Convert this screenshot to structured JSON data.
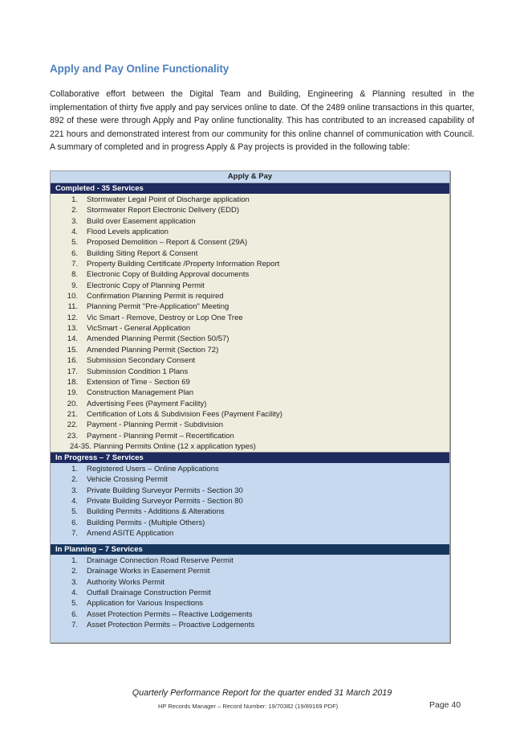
{
  "heading": "Apply and Pay Online Functionality",
  "intro": "Collaborative effort between the Digital Team and Building, Engineering & Planning resulted in the implementation of thirty five apply and pay services online to date.  Of the 2489 online transactions in this quarter, 892 of these were through Apply and Pay online functionality. This has contributed to an increased capability of 221 hours and demonstrated interest from our community for this online channel of communication with Council.  A summary of completed and in progress Apply & Pay projects is provided in the following table:",
  "table": {
    "title": "Apply & Pay",
    "colors": {
      "title_bg": "#c6d9ef",
      "header_navy": "#1f2a5e",
      "header_dark": "#17365d",
      "completed_bg": "#eeeedf",
      "blue_bg": "#c6d9ef"
    },
    "completed": {
      "header": "Completed  - 35 Services",
      "items": [
        {
          "num": "1.",
          "text": "Stormwater Legal Point of Discharge application"
        },
        {
          "num": "2.",
          "text": "Stormwater Report Electronic Delivery (EDD)"
        },
        {
          "num": "3.",
          "text": "Build over Easement application"
        },
        {
          "num": "4.",
          "text": "Flood Levels application"
        },
        {
          "num": "5.",
          "text": "Proposed Demolition – Report & Consent (29A)"
        },
        {
          "num": "6.",
          "text": "Building Siting Report & Consent"
        },
        {
          "num": "7.",
          "text": "Property Building Certificate /Property Information Report"
        },
        {
          "num": "8.",
          "text": "Electronic Copy of Building Approval documents"
        },
        {
          "num": "9.",
          "text": "Electronic Copy of Planning Permit"
        },
        {
          "num": "10.",
          "text": "Confirmation Planning Permit is required"
        },
        {
          "num": "11.",
          "text": "Planning Permit \"Pre-Application\" Meeting"
        },
        {
          "num": "12.",
          "text": "Vic Smart - Remove, Destroy or Lop One Tree"
        },
        {
          "num": "13.",
          "text": "VicSmart - General Application"
        },
        {
          "num": "14.",
          "text": "Amended Planning Permit (Section 50/57)"
        },
        {
          "num": "15.",
          "text": "Amended Planning Permit (Section 72)"
        },
        {
          "num": "16.",
          "text": "Submission Secondary Consent"
        },
        {
          "num": "17.",
          "text": "Submission Condition 1 Plans"
        },
        {
          "num": "18.",
          "text": "Extension of Time - Section 69"
        },
        {
          "num": "19.",
          "text": "Construction Management Plan"
        },
        {
          "num": "20.",
          "text": "Advertising Fees (Payment Facility)"
        },
        {
          "num": "21.",
          "text": "Certification of Lots & Subdivision Fees (Payment Facility)"
        },
        {
          "num": "22.",
          "text": "Payment - Planning Permit - Subdivision"
        },
        {
          "num": "23.",
          "text": "Payment - Planning Permit – Recertification"
        }
      ],
      "final_item": "24-35. Planning Permits Online (12 x application types)"
    },
    "in_progress": {
      "header": "In Progress – 7 Services",
      "items": [
        {
          "num": "1.",
          "text": "Registered Users – Online Applications"
        },
        {
          "num": "2.",
          "text": "Vehicle Crossing Permit"
        },
        {
          "num": "3.",
          "text": "Private Building Surveyor Permits - Section 30"
        },
        {
          "num": "4.",
          "text": "Private Building Surveyor Permits - Section 80"
        },
        {
          "num": "5.",
          "text": "Building Permits - Additions & Alterations"
        },
        {
          "num": "6.",
          "text": "Building Permits - (Multiple Others)"
        },
        {
          "num": "7.",
          "text": "Amend ASITE Application"
        }
      ]
    },
    "in_planning": {
      "header": "In Planning – 7 Services",
      "items": [
        {
          "num": "1.",
          "text": "Drainage Connection Road Reserve Permit"
        },
        {
          "num": "2.",
          "text": "Drainage Works in Easement Permit"
        },
        {
          "num": "3.",
          "text": "Authority Works Permit"
        },
        {
          "num": "4.",
          "text": "Outfall Drainage Construction Permit"
        },
        {
          "num": "5.",
          "text": "Application for Various Inspections"
        },
        {
          "num": "6.",
          "text": "Asset Protection Permits – Reactive Lodgements"
        },
        {
          "num": "7.",
          "text": "Asset Protection Permits – Proactive Lodgements"
        }
      ]
    }
  },
  "footer": {
    "title": "Quarterly Performance Report for the quarter ended 31 March 2019",
    "record": "HP Records Manager – Record Number: 19/70382 (19/89169 PDF)",
    "page": "Page 40"
  }
}
